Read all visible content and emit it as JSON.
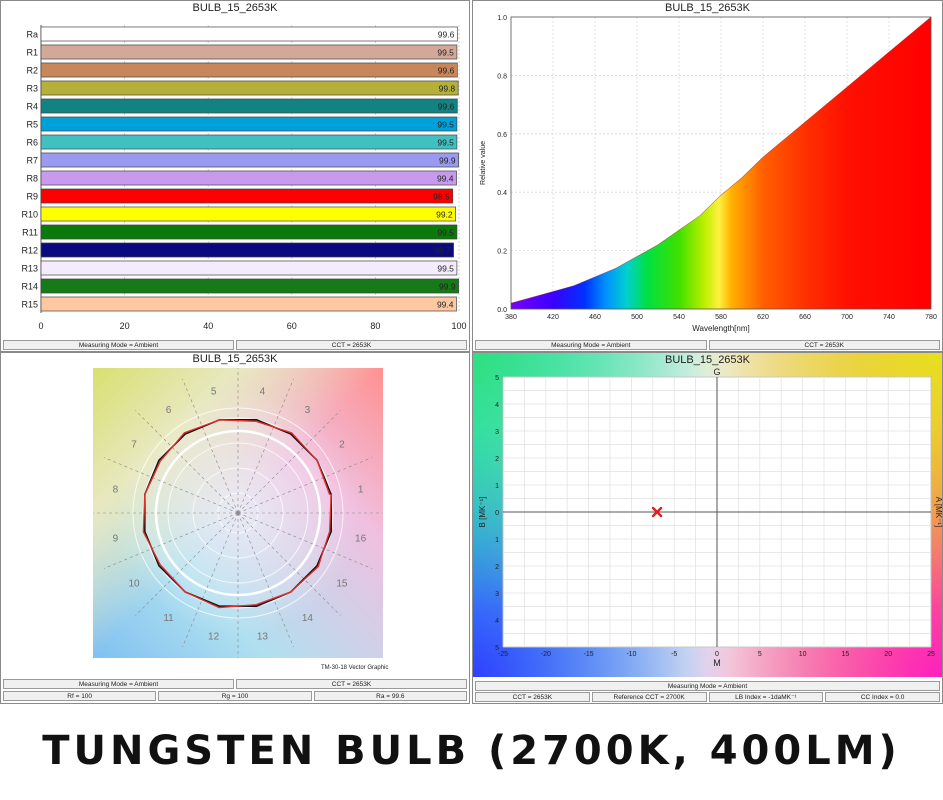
{
  "caption": "TUNGSTEN BULB (2700K, 400LM)",
  "status": {
    "measuring_mode": "Measuring Mode = Ambient",
    "cct": "CCT = 2653K",
    "rf": "Rf = 100",
    "rg": "Rg = 100",
    "ra": "Ra = 99.6",
    "reference_cct": "Reference CCT = 2700K",
    "lb_index": "LB Index = -1daMK⁻¹",
    "cc_index": "CC Index = 0.0"
  },
  "cri_panel": {
    "title": "BULB_15_2653K",
    "chart_data": {
      "type": "bar",
      "orientation": "horizontal",
      "categories": [
        "Ra",
        "R1",
        "R2",
        "R3",
        "R4",
        "R5",
        "R6",
        "R7",
        "R8",
        "R9",
        "R10",
        "R11",
        "R12",
        "R13",
        "R14",
        "R15"
      ],
      "values": [
        99.6,
        99.5,
        99.6,
        99.8,
        99.6,
        99.5,
        99.5,
        99.9,
        99.4,
        98.5,
        99.2,
        99.5,
        98.7,
        99.5,
        99.9,
        99.4
      ],
      "labels": [
        "99.6",
        "99.5",
        "99.6",
        "99.8",
        "99.6",
        "99.5",
        "99.5",
        "99.9",
        "99.4",
        "98.5",
        "99.2",
        "99.5",
        "98.7",
        "99.5",
        "99.9",
        "99.4"
      ],
      "colors": [
        "#ffffff",
        "#d4a898",
        "#c8875a",
        "#b5b03a",
        "#128282",
        "#00a0d8",
        "#40c0c0",
        "#9a9af0",
        "#c79aee",
        "#ff0000",
        "#ffff00",
        "#0a7a0a",
        "#0a0a80",
        "#f4ecfc",
        "#167a16",
        "#ffc8a0"
      ],
      "xlim": [
        0,
        100
      ],
      "xticks": [
        "0",
        "20",
        "40",
        "60",
        "80",
        "100"
      ],
      "grid": true
    }
  },
  "spectrum_panel": {
    "title": "BULB_15_2653K",
    "chart_data": {
      "type": "area",
      "xlabel": "Wavelength[nm]",
      "ylabel": "Relative value",
      "xlim": [
        380,
        780
      ],
      "ylim": [
        0,
        1
      ],
      "xticks": [
        "380",
        "420",
        "460",
        "500",
        "540",
        "580",
        "620",
        "660",
        "700",
        "740",
        "780"
      ],
      "yticks": [
        "0.0",
        "0.2",
        "0.4",
        "0.6",
        "0.8",
        "1.0"
      ],
      "x": [
        380,
        400,
        420,
        440,
        460,
        480,
        500,
        520,
        540,
        560,
        580,
        600,
        620,
        640,
        660,
        680,
        700,
        720,
        740,
        760,
        780
      ],
      "y": [
        0.02,
        0.04,
        0.06,
        0.08,
        0.11,
        0.14,
        0.18,
        0.22,
        0.27,
        0.32,
        0.39,
        0.45,
        0.52,
        0.58,
        0.64,
        0.7,
        0.76,
        0.82,
        0.88,
        0.94,
        1.0
      ],
      "fill": "visible-spectrum gradient",
      "grid": true
    }
  },
  "tm30_panel": {
    "title": "BULB_15_2653K",
    "graphic_label": "TM-30-18 Vector Graphic",
    "hue_bins": [
      "1",
      "2",
      "3",
      "4",
      "5",
      "6",
      "7",
      "8",
      "9",
      "10",
      "11",
      "12",
      "13",
      "14",
      "15",
      "16"
    ]
  },
  "duv_panel": {
    "title": "BULB_15_2653K",
    "top_label": "G",
    "bottom_label": "M",
    "left_label": "B [MK⁻¹]",
    "right_label": "A [MK⁻¹]",
    "chart_data": {
      "type": "scatter",
      "xlim": [
        -25,
        25
      ],
      "ylim": [
        -5,
        5
      ],
      "xticks": [
        "-25",
        "-20",
        "-15",
        "-10",
        "-5",
        "0",
        "5",
        "10",
        "15",
        "20",
        "25"
      ],
      "yticks": [
        "5",
        "4",
        "3",
        "2",
        "1",
        "0",
        "1",
        "2",
        "3",
        "4",
        "5"
      ],
      "points": [
        {
          "x": -7,
          "y": 0
        }
      ],
      "marker": "x",
      "marker_color": "#e02020",
      "grid": true
    }
  }
}
